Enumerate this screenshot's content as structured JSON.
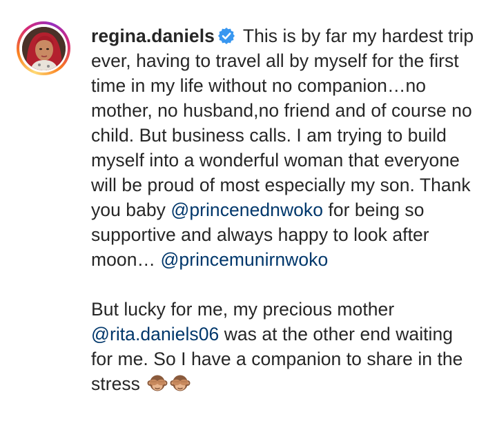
{
  "post": {
    "username": "regina.daniels",
    "verified_icon": "verified-badge-icon",
    "verified_color": "#3897f0",
    "mention_color": "#00376b",
    "segments": {
      "s1": " This is by far my hardest trip ever, having to travel all by myself for the first time in my life without no companion…no mother, no husband,no friend and of course no child. But business calls. I am trying to build myself into a wonderful woman that everyone will be proud of most especially my son. Thank you baby ",
      "m1": "@princenednwoko",
      "s2": " for being so supportive and always happy to look after moon… ",
      "m2": "@princemunirnwoko",
      "s3": "But lucky for me, my precious mother ",
      "m3": "@rita.daniels06",
      "s4": " was at the other end waiting for me. So I have a companion to share in the stress "
    },
    "emojis": [
      "see-no-evil-monkey-icon",
      "see-no-evil-monkey-icon"
    ]
  }
}
